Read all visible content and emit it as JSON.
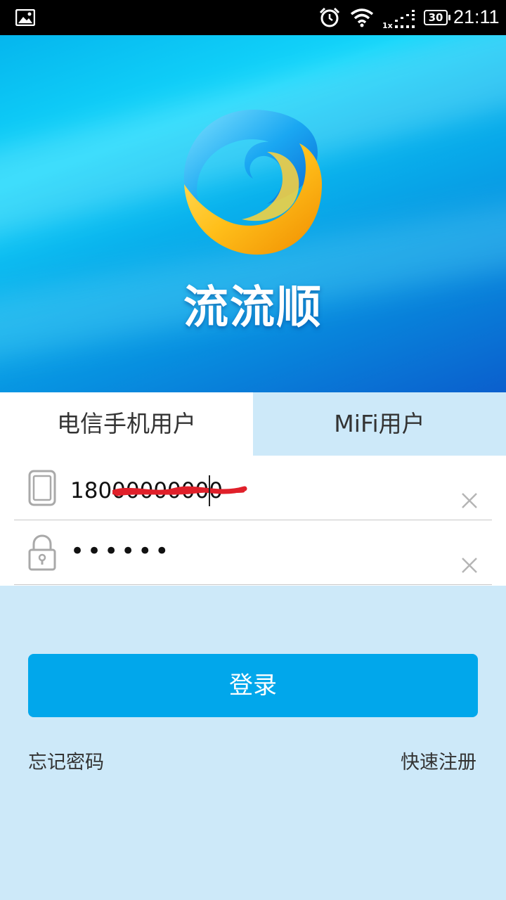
{
  "status_bar": {
    "network_label": "1x",
    "battery": "30",
    "time": "21:11"
  },
  "hero": {
    "brand": "流流顺"
  },
  "tabs": [
    {
      "label": "电信手机用户",
      "active": true
    },
    {
      "label": "MiFi用户",
      "active": false
    }
  ],
  "form": {
    "phone_value": "18000000000",
    "password_mask": "••••••"
  },
  "login_label": "登录",
  "forgot_label": "忘记密码",
  "register_label": "快速注册",
  "colors": {
    "primary": "#01a7eb",
    "page_bg": "#cde9f9",
    "scribble": "#e0202a"
  }
}
